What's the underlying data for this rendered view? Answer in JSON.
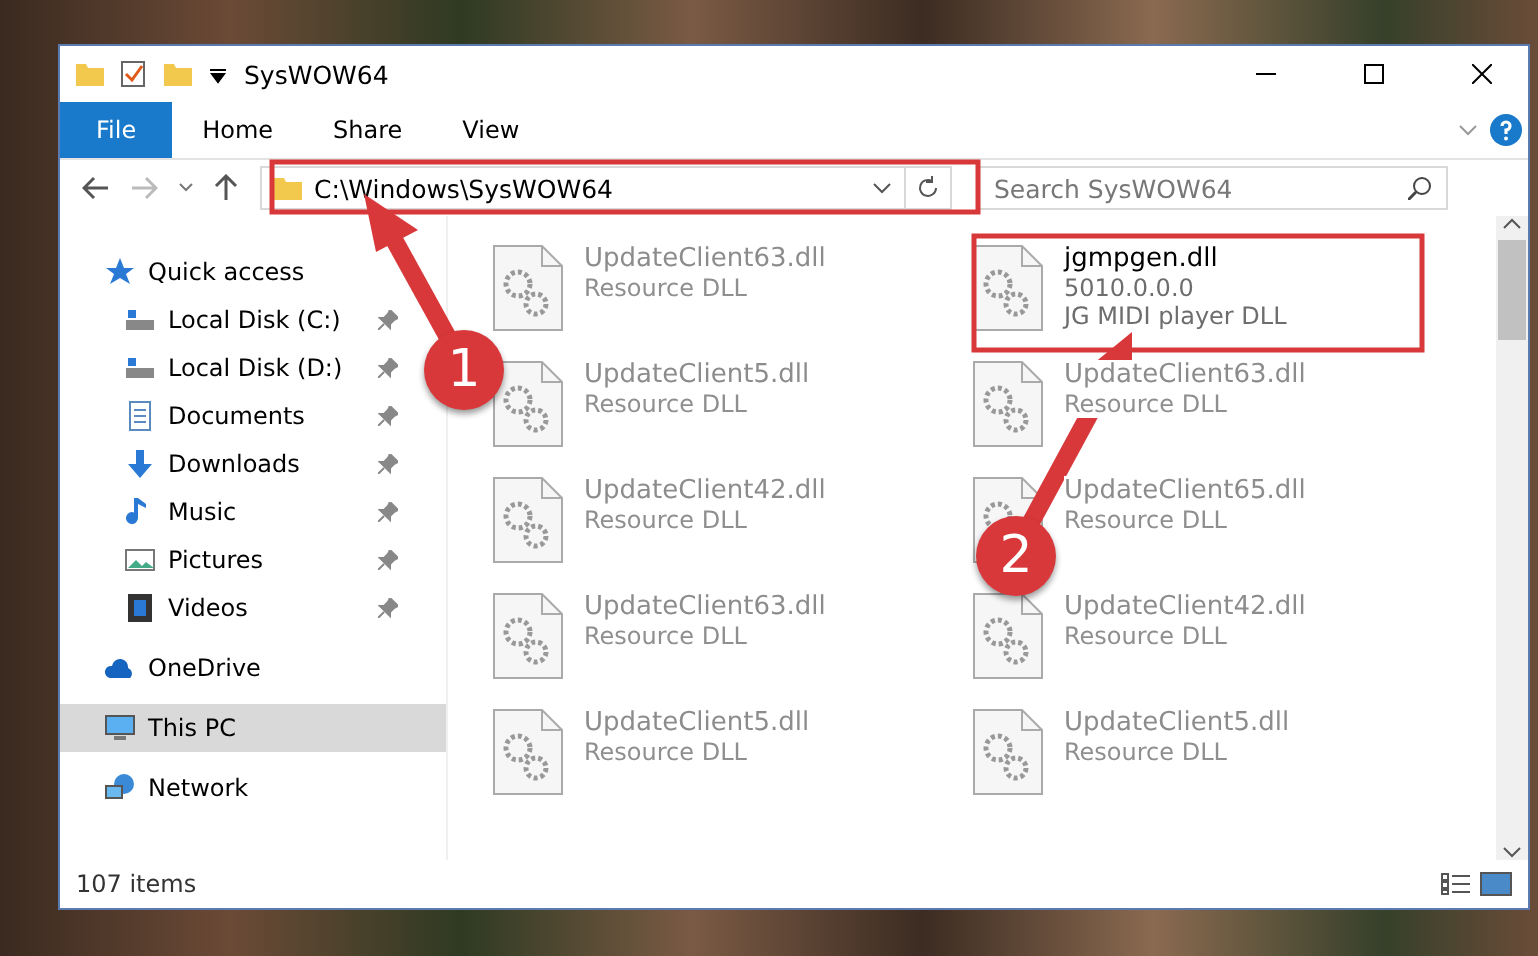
{
  "window": {
    "title": "SysWOW64"
  },
  "ribbon": {
    "tabs": [
      {
        "label": "File",
        "kind": "menu"
      },
      {
        "label": "Home",
        "kind": "tab"
      },
      {
        "label": "Share",
        "kind": "tab"
      },
      {
        "label": "View",
        "kind": "tab"
      }
    ]
  },
  "address": {
    "path": "C:\\Windows\\SysWOW64"
  },
  "search": {
    "placeholder": "Search SysWOW64"
  },
  "sidebar": {
    "items": [
      {
        "label": "Quick access",
        "kind": "star",
        "selected": false,
        "children": [
          {
            "label": "Local Disk (C:)",
            "kind": "drive",
            "pinned": true
          },
          {
            "label": "Local Disk (D:)",
            "kind": "drive",
            "pinned": true
          },
          {
            "label": "Documents",
            "kind": "document",
            "pinned": true
          },
          {
            "label": "Downloads",
            "kind": "download",
            "pinned": true
          },
          {
            "label": "Music",
            "kind": "music",
            "pinned": true
          },
          {
            "label": "Pictures",
            "kind": "pictures",
            "pinned": true
          },
          {
            "label": "Videos",
            "kind": "videos",
            "pinned": true
          }
        ]
      },
      {
        "label": "OneDrive",
        "kind": "cloud",
        "selected": false
      },
      {
        "label": "This PC",
        "kind": "computer",
        "selected": true
      },
      {
        "label": "Network",
        "kind": "network",
        "selected": false
      }
    ]
  },
  "files": [
    {
      "name": "UpdateClient63.dll",
      "lines": [
        "Resource DLL"
      ],
      "faded": true
    },
    {
      "name": "jgmpgen.dll",
      "lines": [
        "5010.0.0.0",
        "JG MIDI player DLL"
      ],
      "faded": false
    },
    {
      "name": "UpdateClient5.dll",
      "lines": [
        "Resource DLL"
      ],
      "faded": true
    },
    {
      "name": "UpdateClient63.dll",
      "lines": [
        "Resource DLL"
      ],
      "faded": true
    },
    {
      "name": "UpdateClient42.dll",
      "lines": [
        "Resource DLL"
      ],
      "faded": true
    },
    {
      "name": "UpdateClient65.dll",
      "lines": [
        "Resource DLL"
      ],
      "faded": true
    },
    {
      "name": "UpdateClient63.dll",
      "lines": [
        "Resource DLL"
      ],
      "faded": true
    },
    {
      "name": "UpdateClient42.dll",
      "lines": [
        "Resource DLL"
      ],
      "faded": true
    },
    {
      "name": "UpdateClient5.dll",
      "lines": [
        "Resource DLL"
      ],
      "faded": true
    },
    {
      "name": "UpdateClient5.dll",
      "lines": [
        "Resource DLL"
      ],
      "faded": true
    }
  ],
  "status_bar": {
    "count": "107 items"
  },
  "annotations": [
    {
      "number": "1"
    },
    {
      "number": "2"
    }
  ]
}
